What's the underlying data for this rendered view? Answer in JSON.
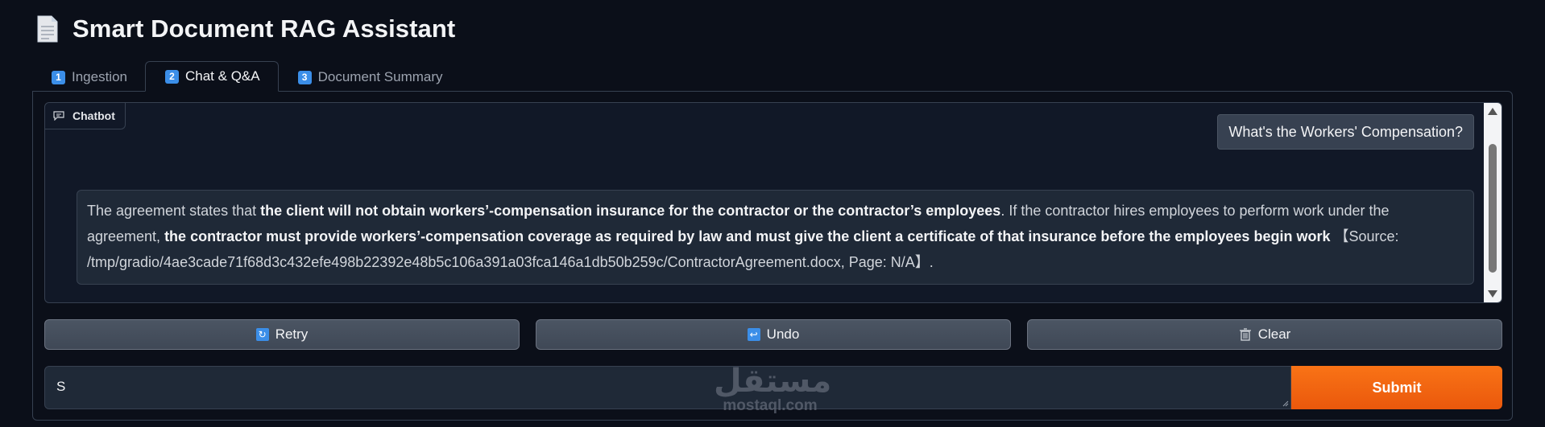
{
  "app": {
    "title": "Smart Document RAG Assistant",
    "icon": "document-icon"
  },
  "tabs": [
    {
      "number": "1",
      "label": "Ingestion",
      "active": false
    },
    {
      "number": "2",
      "label": "Chat & Q&A",
      "active": true
    },
    {
      "number": "3",
      "label": "Document Summary",
      "active": false
    }
  ],
  "chatbot": {
    "label": "Chatbot",
    "user_message": "What's the Workers' Compensation?",
    "bot_message": {
      "p1": "The agreement states that ",
      "b1": "the client will not obtain workers’-compensation insurance for the contractor or the contractor’s employees",
      "p2": ". If the contractor hires employees to perform work under the agreement, ",
      "b2": "the contractor must provide workers’-compensation coverage as required by law and must give the client a certificate of that insurance before the employees begin work",
      "p3": "【Source: /tmp/gradio/4ae3cade71f68d3c432efe498b22392e48b5c106a391a03fca146a1db50b259c/ContractorAgreement.docx, Page: N/A】."
    }
  },
  "buttons": {
    "retry": "Retry",
    "undo": "Undo",
    "clear": "Clear"
  },
  "input": {
    "value": "S"
  },
  "submit_label": "Submit",
  "watermark": {
    "arabic": "مستقل",
    "latin": "mostaql.com"
  },
  "colors": {
    "background": "#0b0f19",
    "accent": "#f97316",
    "badge": "#3b8ee8"
  }
}
